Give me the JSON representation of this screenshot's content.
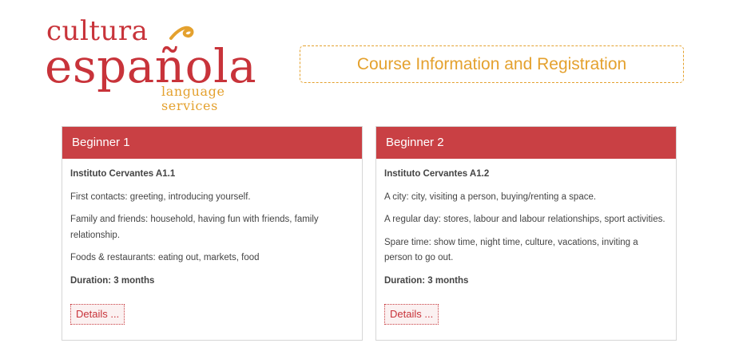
{
  "logo": {
    "top": "cultura",
    "main": "española",
    "sub": "language services"
  },
  "header": {
    "title": "Course Information and Registration"
  },
  "courses": [
    {
      "title": "Beginner 1",
      "institute": "Instituto Cervantes A1.1",
      "topics": [
        "First contacts: greeting, introducing yourself.",
        "Family and friends: household, having fun with friends, family relationship.",
        "Foods & restaurants: eating out, markets, food"
      ],
      "duration": "Duration: 3 months",
      "button": "Details ..."
    },
    {
      "title": "Beginner 2",
      "institute": "Instituto Cervantes A1.2",
      "topics": [
        "A city: city, visiting a person, buying/renting a space.",
        "A regular day: stores, labour and labour relationships, sport activities.",
        "Spare time: show time, night time, culture, vacations, inviting a person to go out."
      ],
      "duration": "Duration: 3 months",
      "button": "Details ..."
    }
  ],
  "colors": {
    "brand_red": "#c8333a",
    "brand_orange": "#e4a12e",
    "card_header": "#c94044"
  }
}
